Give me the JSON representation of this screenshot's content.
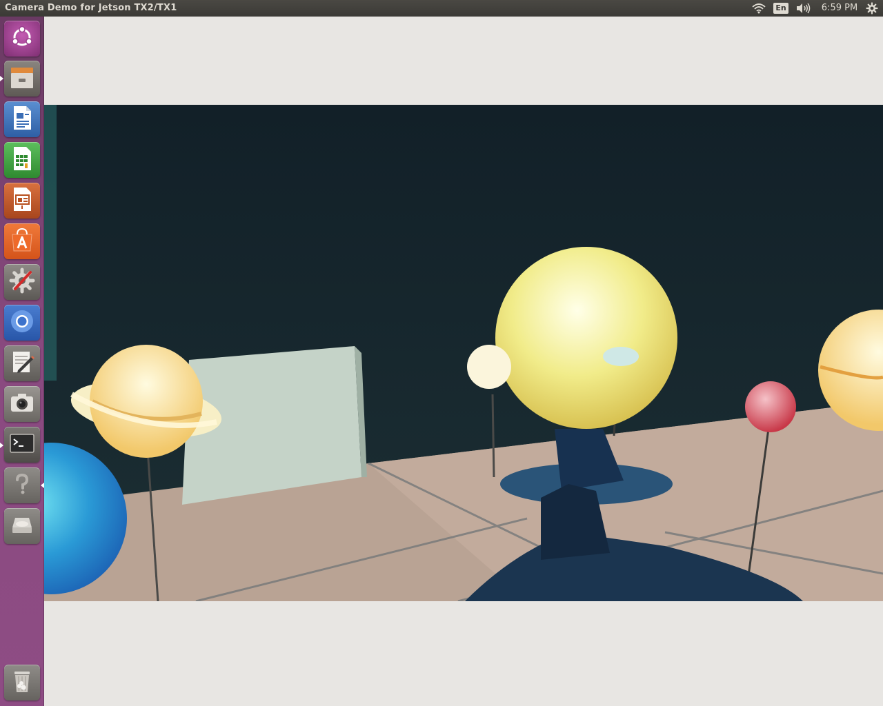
{
  "panel": {
    "window_title": "Camera Demo for Jetson TX2/TX1",
    "indicators": {
      "network": "wifi-icon",
      "keyboard_layout": "En",
      "sound": "volume-icon",
      "clock": "6:59 PM",
      "system": "gear-icon"
    }
  },
  "launcher": {
    "items": [
      {
        "name": "dash-home",
        "icon": "ubuntu-logo-icon"
      },
      {
        "name": "files",
        "icon": "file-cabinet-icon"
      },
      {
        "name": "libreoffice-writer",
        "icon": "document-icon"
      },
      {
        "name": "libreoffice-calc",
        "icon": "spreadsheet-icon"
      },
      {
        "name": "libreoffice-impress",
        "icon": "presentation-icon"
      },
      {
        "name": "ubuntu-software",
        "icon": "shopping-bag-icon"
      },
      {
        "name": "system-settings",
        "icon": "settings-wrench-icon"
      },
      {
        "name": "chromium",
        "icon": "browser-icon"
      },
      {
        "name": "text-editor",
        "icon": "pencil-note-icon"
      },
      {
        "name": "camera-app",
        "icon": "camera-icon"
      },
      {
        "name": "terminal",
        "icon": "terminal-icon"
      },
      {
        "name": "help",
        "icon": "question-mark-icon"
      },
      {
        "name": "disk",
        "icon": "disk-drive-icon"
      },
      {
        "name": "trash",
        "icon": "trash-icon"
      }
    ]
  },
  "camera": {
    "content": "live-camera-feed"
  },
  "colors": {
    "launcher": "#8a4a80",
    "panel": "#3b3a36",
    "window_bg": "#e8e6e3"
  }
}
